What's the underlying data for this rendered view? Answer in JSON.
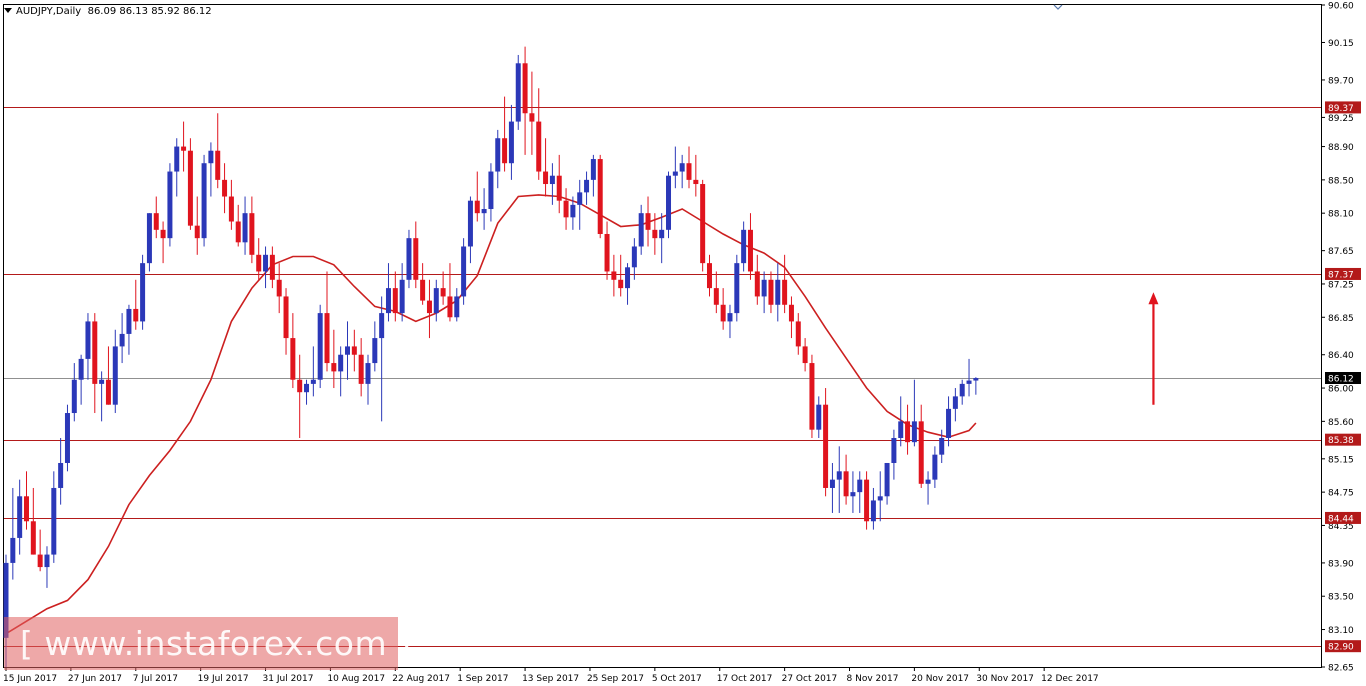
{
  "header": {
    "symbol": "AUDJPY,Daily",
    "ohlc": "86.09 86.13 85.92 86.12"
  },
  "watermark": "[ www.instaforex.com ]",
  "colors": {
    "bull": "#2b38b8",
    "bear": "#e0141e",
    "ma": "#cc2020",
    "level": "#b31a1a",
    "current": "#909090"
  },
  "chart_data": {
    "type": "candlestick",
    "title": "AUDJPY,Daily",
    "y_axis": {
      "min": 82.65,
      "max": 90.6,
      "ticks": [
        "90.60",
        "90.15",
        "89.70",
        "89.25",
        "88.90",
        "88.50",
        "88.10",
        "87.65",
        "87.25",
        "86.85",
        "86.40",
        "86.00",
        "85.60",
        "85.15",
        "84.75",
        "84.35",
        "83.90",
        "83.50",
        "83.10",
        "82.65"
      ]
    },
    "x_labels": [
      "15 Jun 2017",
      "27 Jun 2017",
      "7 Jul 2017",
      "19 Jul 2017",
      "31 Jul 2017",
      "10 Aug 2017",
      "22 Aug 2017",
      "1 Sep 2017",
      "13 Sep 2017",
      "25 Sep 2017",
      "5 Oct 2017",
      "17 Oct 2017",
      "27 Oct 2017",
      "8 Nov 2017",
      "20 Nov 2017",
      "30 Nov 2017",
      "12 Dec 2017"
    ],
    "current_price": "86.12",
    "levels": [
      {
        "label": "89.37",
        "value": 89.37
      },
      {
        "label": "87.37",
        "value": 87.37
      },
      {
        "label": "85.38",
        "value": 85.38
      },
      {
        "label": "84.44",
        "value": 84.44
      },
      {
        "label": "82.90",
        "value": 82.9
      }
    ],
    "annotation": {
      "type": "arrow-up",
      "from": 85.8,
      "to": 87.15,
      "at_bar": 168
    },
    "moving_average": [
      [
        0,
        83.05
      ],
      [
        3,
        83.2
      ],
      [
        6,
        83.35
      ],
      [
        9,
        83.45
      ],
      [
        12,
        83.7
      ],
      [
        15,
        84.1
      ],
      [
        18,
        84.6
      ],
      [
        21,
        84.95
      ],
      [
        24,
        85.25
      ],
      [
        27,
        85.6
      ],
      [
        30,
        86.1
      ],
      [
        33,
        86.8
      ],
      [
        36,
        87.2
      ],
      [
        39,
        87.48
      ],
      [
        42,
        87.58
      ],
      [
        45,
        87.58
      ],
      [
        48,
        87.48
      ],
      [
        51,
        87.22
      ],
      [
        54,
        86.98
      ],
      [
        57,
        86.92
      ],
      [
        60,
        86.8
      ],
      [
        63,
        86.9
      ],
      [
        66,
        87.05
      ],
      [
        69,
        87.35
      ],
      [
        72,
        87.98
      ],
      [
        75,
        88.3
      ],
      [
        78,
        88.32
      ],
      [
        81,
        88.3
      ],
      [
        84,
        88.22
      ],
      [
        87,
        88.08
      ],
      [
        90,
        87.94
      ],
      [
        93,
        87.96
      ],
      [
        96,
        88.05
      ],
      [
        99,
        88.15
      ],
      [
        102,
        88.0
      ],
      [
        105,
        87.85
      ],
      [
        108,
        87.72
      ],
      [
        111,
        87.62
      ],
      [
        114,
        87.45
      ],
      [
        117,
        87.1
      ],
      [
        120,
        86.72
      ],
      [
        123,
        86.36
      ],
      [
        126,
        86.0
      ],
      [
        129,
        85.72
      ],
      [
        132,
        85.56
      ],
      [
        135,
        85.47
      ],
      [
        138,
        85.41
      ],
      [
        141,
        85.49
      ],
      [
        142,
        85.58
      ]
    ],
    "candles": [
      [
        83.0,
        84.0,
        82.65,
        83.9
      ],
      [
        83.9,
        84.8,
        83.7,
        84.2
      ],
      [
        84.2,
        84.9,
        84.0,
        84.7
      ],
      [
        84.7,
        85.0,
        84.3,
        84.4
      ],
      [
        84.4,
        84.8,
        84.0,
        84.0
      ],
      [
        84.0,
        84.3,
        83.8,
        83.85
      ],
      [
        83.85,
        84.1,
        83.6,
        84.0
      ],
      [
        84.0,
        85.0,
        83.9,
        84.8
      ],
      [
        84.8,
        85.4,
        84.6,
        85.1
      ],
      [
        85.1,
        85.8,
        85.0,
        85.7
      ],
      [
        85.7,
        86.3,
        85.6,
        86.1
      ],
      [
        86.1,
        86.4,
        85.8,
        86.35
      ],
      [
        86.35,
        86.9,
        86.1,
        86.8
      ],
      [
        86.8,
        86.9,
        85.7,
        86.05
      ],
      [
        86.05,
        86.2,
        85.6,
        86.1
      ],
      [
        86.1,
        86.5,
        85.8,
        85.8
      ],
      [
        85.8,
        86.7,
        85.7,
        86.5
      ],
      [
        86.5,
        86.9,
        86.3,
        86.65
      ],
      [
        86.65,
        87.0,
        86.4,
        86.95
      ],
      [
        86.95,
        87.3,
        86.7,
        86.8
      ],
      [
        86.8,
        87.6,
        86.7,
        87.5
      ],
      [
        87.5,
        88.1,
        87.4,
        88.1
      ],
      [
        88.1,
        88.3,
        87.8,
        87.9
      ],
      [
        87.9,
        88.0,
        87.5,
        87.8
      ],
      [
        87.8,
        88.7,
        87.7,
        88.6
      ],
      [
        88.6,
        89.0,
        88.3,
        88.9
      ],
      [
        88.9,
        89.2,
        88.6,
        88.85
      ],
      [
        88.85,
        89.0,
        87.9,
        87.95
      ],
      [
        87.95,
        88.3,
        87.6,
        87.8
      ],
      [
        87.8,
        88.8,
        87.7,
        88.7
      ],
      [
        88.7,
        88.95,
        88.3,
        88.85
      ],
      [
        88.85,
        89.3,
        88.4,
        88.5
      ],
      [
        88.5,
        88.7,
        88.1,
        88.3
      ],
      [
        88.3,
        88.5,
        87.9,
        88.0
      ],
      [
        88.0,
        88.2,
        87.7,
        87.75
      ],
      [
        87.75,
        88.3,
        87.6,
        88.1
      ],
      [
        88.1,
        88.3,
        87.5,
        87.6
      ],
      [
        87.6,
        87.8,
        87.3,
        87.4
      ],
      [
        87.4,
        87.7,
        87.2,
        87.6
      ],
      [
        87.6,
        87.7,
        87.2,
        87.3
      ],
      [
        87.3,
        87.5,
        86.9,
        87.1
      ],
      [
        87.1,
        87.2,
        86.4,
        86.6
      ],
      [
        86.6,
        86.9,
        86.0,
        86.1
      ],
      [
        86.1,
        86.4,
        85.4,
        85.95
      ],
      [
        85.95,
        86.1,
        85.8,
        86.05
      ],
      [
        86.05,
        86.5,
        85.9,
        86.1
      ],
      [
        86.1,
        87.0,
        86.0,
        86.9
      ],
      [
        86.9,
        87.4,
        86.2,
        86.3
      ],
      [
        86.3,
        86.7,
        86.0,
        86.2
      ],
      [
        86.2,
        86.5,
        85.9,
        86.4
      ],
      [
        86.4,
        86.8,
        86.1,
        86.5
      ],
      [
        86.5,
        86.7,
        86.2,
        86.4
      ],
      [
        86.4,
        86.6,
        85.9,
        86.05
      ],
      [
        86.05,
        86.4,
        85.8,
        86.3
      ],
      [
        86.3,
        86.8,
        86.2,
        86.6
      ],
      [
        86.6,
        87.1,
        85.6,
        86.9
      ],
      [
        86.9,
        87.5,
        86.8,
        87.2
      ],
      [
        87.2,
        87.4,
        86.8,
        86.9
      ],
      [
        86.9,
        87.5,
        86.8,
        87.3
      ],
      [
        87.3,
        87.9,
        87.2,
        87.8
      ],
      [
        87.8,
        88.0,
        87.2,
        87.3
      ],
      [
        87.3,
        87.5,
        87.0,
        87.05
      ],
      [
        87.05,
        87.3,
        86.6,
        86.9
      ],
      [
        86.9,
        87.3,
        86.8,
        87.2
      ],
      [
        87.2,
        87.4,
        87.0,
        87.1
      ],
      [
        87.1,
        87.5,
        86.8,
        86.85
      ],
      [
        86.85,
        87.2,
        86.8,
        87.1
      ],
      [
        87.1,
        87.8,
        87.0,
        87.7
      ],
      [
        87.7,
        88.3,
        87.5,
        88.25
      ],
      [
        88.25,
        88.6,
        88.0,
        88.1
      ],
      [
        88.1,
        88.4,
        87.9,
        88.15
      ],
      [
        88.15,
        88.7,
        88.0,
        88.6
      ],
      [
        88.6,
        89.1,
        88.4,
        89.0
      ],
      [
        89.0,
        89.5,
        88.6,
        88.7
      ],
      [
        88.7,
        89.4,
        88.5,
        89.2
      ],
      [
        89.2,
        90.0,
        89.1,
        89.9
      ],
      [
        89.9,
        90.1,
        88.8,
        89.3
      ],
      [
        89.3,
        89.8,
        88.8,
        89.2
      ],
      [
        89.2,
        89.6,
        88.5,
        88.6
      ],
      [
        88.6,
        89.0,
        88.3,
        88.45
      ],
      [
        88.45,
        88.7,
        88.2,
        88.55
      ],
      [
        88.55,
        88.8,
        88.1,
        88.25
      ],
      [
        88.25,
        88.4,
        87.9,
        88.05
      ],
      [
        88.05,
        88.3,
        87.9,
        88.2
      ],
      [
        88.2,
        88.5,
        87.9,
        88.35
      ],
      [
        88.35,
        88.6,
        88.2,
        88.5
      ],
      [
        88.5,
        88.8,
        88.3,
        88.75
      ],
      [
        88.75,
        88.8,
        87.8,
        87.85
      ],
      [
        87.85,
        88.0,
        87.3,
        87.4
      ],
      [
        87.4,
        87.6,
        87.1,
        87.3
      ],
      [
        87.3,
        87.6,
        87.1,
        87.2
      ],
      [
        87.2,
        87.5,
        87.0,
        87.45
      ],
      [
        87.45,
        87.8,
        87.3,
        87.7
      ],
      [
        87.7,
        88.2,
        87.6,
        88.1
      ],
      [
        88.1,
        88.3,
        87.7,
        87.9
      ],
      [
        87.9,
        88.1,
        87.6,
        87.8
      ],
      [
        87.8,
        88.1,
        87.5,
        87.9
      ],
      [
        87.9,
        88.6,
        87.8,
        88.55
      ],
      [
        88.55,
        88.9,
        88.4,
        88.6
      ],
      [
        88.6,
        88.8,
        88.4,
        88.7
      ],
      [
        88.7,
        88.9,
        88.4,
        88.5
      ],
      [
        88.5,
        88.8,
        88.3,
        88.45
      ],
      [
        88.45,
        88.5,
        87.4,
        87.5
      ],
      [
        87.5,
        87.6,
        87.1,
        87.2
      ],
      [
        87.2,
        87.4,
        86.9,
        87.0
      ],
      [
        87.0,
        87.2,
        86.7,
        86.8
      ],
      [
        86.8,
        87.0,
        86.6,
        86.9
      ],
      [
        86.9,
        87.6,
        86.8,
        87.5
      ],
      [
        87.5,
        88.0,
        87.4,
        87.9
      ],
      [
        87.9,
        88.1,
        87.3,
        87.4
      ],
      [
        87.4,
        87.6,
        87.0,
        87.1
      ],
      [
        87.1,
        87.4,
        86.9,
        87.3
      ],
      [
        87.3,
        87.4,
        86.9,
        87.0
      ],
      [
        87.0,
        87.5,
        86.8,
        87.3
      ],
      [
        87.3,
        87.6,
        86.9,
        87.0
      ],
      [
        87.0,
        87.1,
        86.6,
        86.8
      ],
      [
        86.8,
        86.9,
        86.4,
        86.5
      ],
      [
        86.5,
        86.6,
        86.2,
        86.3
      ],
      [
        86.3,
        86.4,
        85.4,
        85.5
      ],
      [
        85.5,
        85.9,
        85.4,
        85.8
      ],
      [
        85.8,
        86.0,
        84.7,
        84.8
      ],
      [
        84.8,
        85.1,
        84.5,
        84.9
      ],
      [
        84.9,
        85.3,
        84.5,
        85.0
      ],
      [
        85.0,
        85.2,
        84.6,
        84.7
      ],
      [
        84.7,
        85.0,
        84.5,
        84.75
      ],
      [
        84.75,
        85.0,
        84.5,
        84.9
      ],
      [
        84.9,
        85.0,
        84.3,
        84.4
      ],
      [
        84.4,
        84.8,
        84.3,
        84.65
      ],
      [
        84.65,
        85.0,
        84.4,
        84.7
      ],
      [
        84.7,
        85.1,
        84.6,
        85.1
      ],
      [
        85.1,
        85.5,
        84.9,
        85.4
      ],
      [
        85.4,
        85.9,
        85.3,
        85.6
      ],
      [
        85.6,
        85.8,
        85.2,
        85.35
      ],
      [
        85.35,
        86.1,
        85.3,
        85.6
      ],
      [
        85.6,
        85.8,
        84.8,
        84.85
      ],
      [
        84.85,
        85.0,
        84.6,
        84.9
      ],
      [
        84.9,
        85.3,
        84.8,
        85.2
      ],
      [
        85.2,
        85.5,
        85.1,
        85.4
      ],
      [
        85.4,
        85.9,
        85.3,
        85.75
      ],
      [
        85.75,
        86.0,
        85.6,
        85.9
      ],
      [
        85.9,
        86.1,
        85.8,
        86.05
      ],
      [
        86.05,
        86.35,
        85.9,
        86.09
      ],
      [
        86.09,
        86.13,
        85.92,
        86.12
      ]
    ]
  }
}
